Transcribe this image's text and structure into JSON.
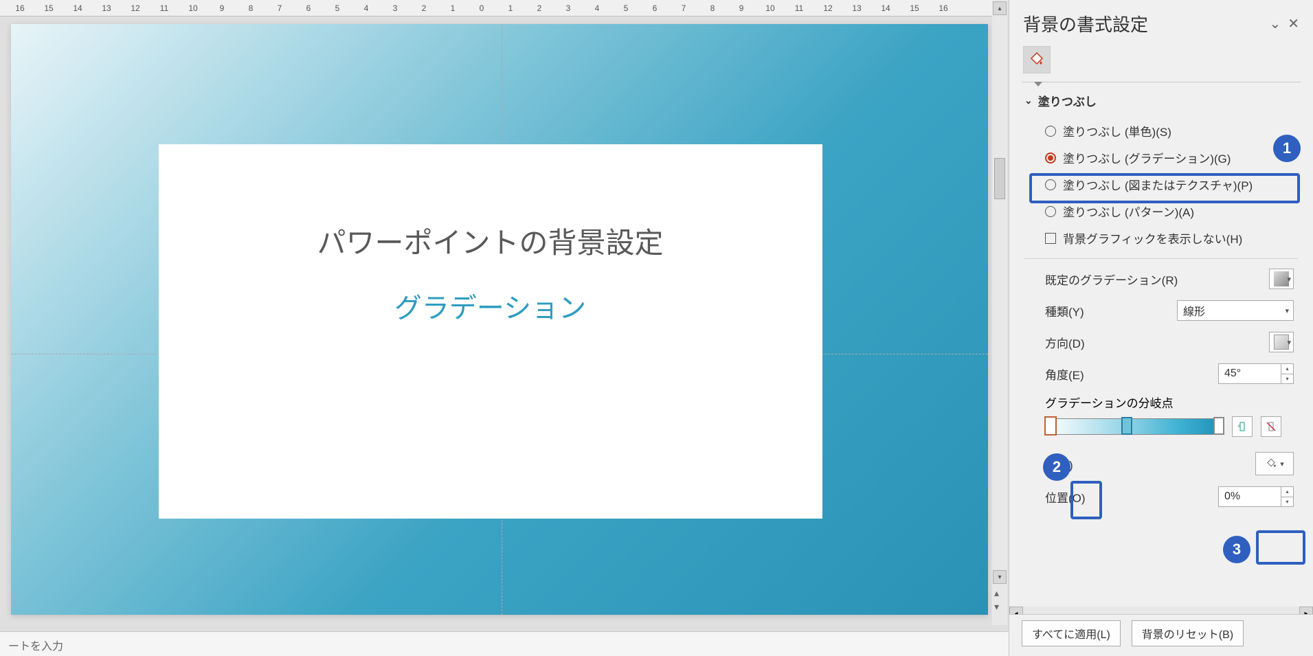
{
  "ruler": {
    "ticks": [
      "16",
      "15",
      "14",
      "13",
      "12",
      "11",
      "10",
      "9",
      "8",
      "7",
      "6",
      "5",
      "4",
      "3",
      "2",
      "1",
      "0",
      "1",
      "2",
      "3",
      "4",
      "5",
      "6",
      "7",
      "8",
      "9",
      "10",
      "11",
      "12",
      "13",
      "14",
      "15",
      "16"
    ]
  },
  "slide": {
    "title": "パワーポイントの背景設定",
    "subtitle": "グラデーション"
  },
  "panel": {
    "title": "背景の書式設定",
    "section_fill": "塗りつぶし",
    "radios": {
      "solid": "塗りつぶし (単色)(S)",
      "gradient": "塗りつぶし (グラデーション)(G)",
      "picture": "塗りつぶし (図またはテクスチャ)(P)",
      "pattern": "塗りつぶし (パターン)(A)"
    },
    "hide_bg": "背景グラフィックを表示しない(H)",
    "preset_label": "既定のグラデーション(R)",
    "type_label": "種類(Y)",
    "type_value": "線形",
    "direction_label": "方向(D)",
    "angle_label": "角度(E)",
    "angle_value": "45°",
    "stops_label": "グラデーションの分岐点",
    "color_label": "色(C)",
    "position_label": "位置(O)",
    "position_value": "0%",
    "apply_all": "すべてに適用(L)",
    "reset_bg": "背景のリセット(B)"
  },
  "callouts": {
    "one": "1",
    "two": "2",
    "three": "3"
  },
  "notes": "ートを入力"
}
